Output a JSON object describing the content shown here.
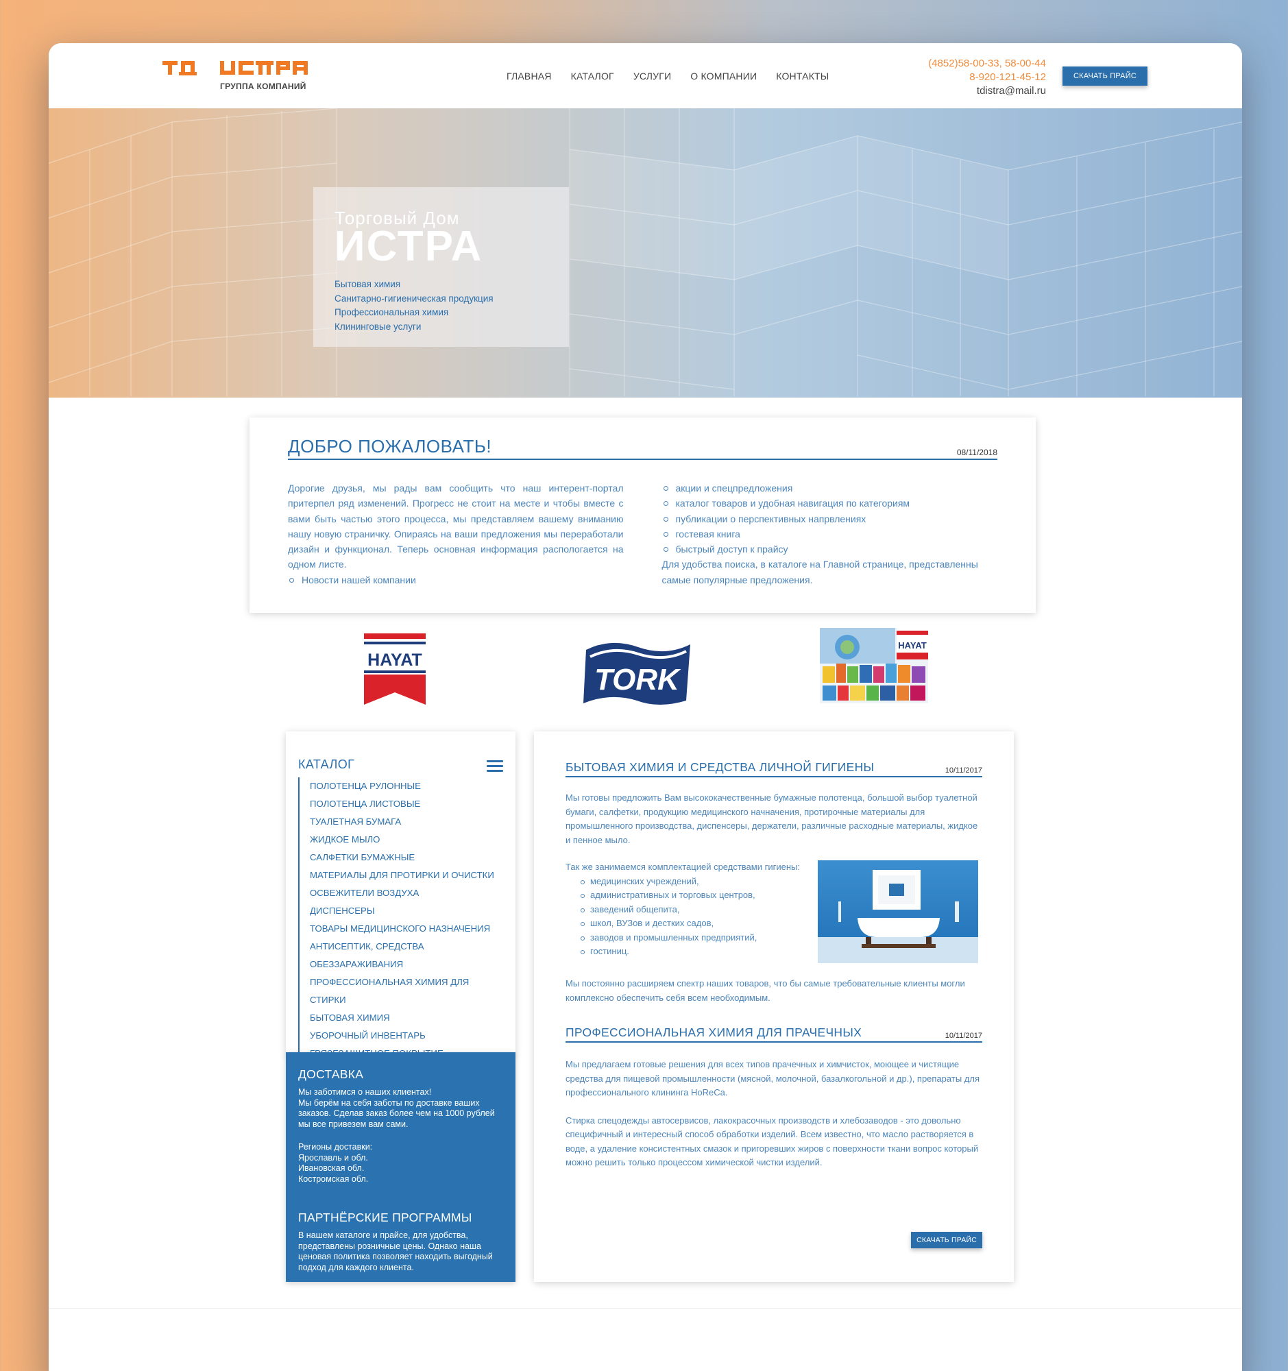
{
  "colors": {
    "accent": "#2a6fac",
    "orange": "#ef8c3c",
    "text_blue": "#4d86ba"
  },
  "header": {
    "logo_main": "ТД ИСТРА",
    "logo_sub": "ГРУППА КОМПАНИЙ",
    "nav": [
      "ГЛАВНАЯ",
      "КАТАЛОГ",
      "УСЛУГИ",
      "О КОМПАНИИ",
      "КОНТАКТЫ"
    ],
    "phone1": "(4852)58-00-33, 58-00-44",
    "phone2": "8-920-121-45-12",
    "email": "tdistra@mail.ru",
    "price_button": "СКАЧАТЬ ПРАЙС"
  },
  "hero": {
    "title_small": "Торговый Дом",
    "title_big": "ИСТРА",
    "items": [
      "Бытовая химия",
      "Санитарно-гигиеническая продукция",
      "Профессиональная химия",
      "Клининговые услуги"
    ]
  },
  "welcome": {
    "title": "ДОБРО ПОЖАЛОВАТЬ!",
    "date": "08/11/2018",
    "text": "Дорогие друзья, мы рады вам сообщить что наш интерент-портал притерпел ряд изменений. Прогресс не стоит на месте и чтобы вместе с вами быть частью этого процесса, мы представляем вашему вниманию нашу новую страничку. Опираясь на ваши предложения мы переработали дизайн и функционал. Теперь основная информация распологается на одном листе.",
    "left_list": [
      "Новости нашей компании"
    ],
    "right_list": [
      "акции и спецпредложения",
      "каталог товаров и удобная навигация по категориям",
      "публикации о перспективных напрвлениях",
      "гостевая книга",
      "быстрый доступ к прайсу"
    ],
    "right_text": "Для удобства поиска, в каталоге на Главной странице, представленны самые популярные предложения."
  },
  "brands": {
    "hayat": "HAYAT",
    "tork": "TORK",
    "hayat2": "HAYAT"
  },
  "catalog": {
    "title": "КАТАЛОГ",
    "items": [
      "ПОЛОТЕНЦА РУЛОННЫЕ",
      "ПОЛОТЕНЦА ЛИСТОВЫЕ",
      "ТУАЛЕТНАЯ БУМАГА",
      "ЖИДКОЕ МЫЛО",
      "САЛФЕТКИ БУМАЖНЫЕ",
      "МАТЕРИАЛЫ ДЛЯ ПРОТИРКИ И ОЧИСТКИ",
      "ОСВЕЖИТЕЛИ ВОЗДУХА",
      "ДИСПЕНСЕРЫ",
      "ТОВАРЫ МЕДИЦИНСКОГО НАЗНАЧЕНИЯ",
      "АНТИСЕПТИК, СРЕДСТВА ОБЕЗЗАРАЖИВАНИЯ",
      "ПРОФЕССИОНАЛЬНАЯ ХИМИЯ ДЛЯ СТИРКИ",
      "БЫТОВАЯ ХИМИЯ",
      "УБОРОЧНЫЙ ИНВЕНТАРЬ",
      "ГРЯЗЕЗАЩИТНОЕ ПОКРЫТИЕ"
    ]
  },
  "delivery": {
    "title": "ДОСТАВКА",
    "text1": "Мы заботимся о наших клиентах!",
    "text2": "Мы берём на себя заботы по доставке ваших заказов. Сделав заказ более чем на 1000 рублей мы все привезем вам сами.",
    "regions_title": "Регионы доставки:",
    "regions": [
      "Ярославль и обл.",
      "Ивановская обл.",
      "Костромская обл."
    ]
  },
  "partners": {
    "title": "ПАРТНЁРСКИЕ ПРОГРАММЫ",
    "text": "В нашем каталоге и прайсе, для удобства, представлены розничные цены. Однако наша ценовая политика позволяет находить выгодный подход для каждого клиента."
  },
  "article1": {
    "title": "БЫТОВАЯ ХИМИЯ И СРЕДСТВА ЛИЧНОЙ ГИГИЕНЫ",
    "date": "10/11/2017",
    "p1": "Мы готовы предложить Вам высококачественные бумажные полотенца, большой выбор туалетной бумаги, салфетки, продукцию медицинского начначения, протирочные материалы для промышленного производства, диспенсеры, держатели, различные расходные материалы, жидкое и пенное мыло.",
    "p2": "Так же занимаемся комплектацией средствами гигиены:",
    "list": [
      "медицинских учреждений,",
      "административных и торговых центров,",
      "заведений общепита,",
      "школ, ВУЗов и дестких садов,",
      "заводов и промышленных предприятий,",
      "гостиниц."
    ],
    "p3": "Мы постоянно расширяем спектр наших товаров, что бы самые требовательные клиенты могли комплексно обеспечить себя всем необходимым."
  },
  "article2": {
    "title": "ПРОФЕССИОНАЛЬНАЯ ХИМИЯ ДЛЯ ПРАЧЕЧНЫХ",
    "date": "10/11/2017",
    "p1": "Мы предлагаем готовые решения для всех типов прачечных и химчисток, моющее и чистящие средства для пищевой промышленности (мясной, молочной, базалкогольной и др.), препараты для профессионального клининга HoReCa.",
    "p2": "Стирка спецодежды автосервисов, лакокрасочных производств и хлебозаводов - это довольно специфичный и интересный способ обработки изделий. Всем известно, что масло растворяется в воде, а удаление консистентных смазок и пригоревших жиров с поверхности ткани вопрос который можно решить только процессом химической чистки изделий.",
    "button": "СКАЧАТЬ ПРАЙС"
  }
}
